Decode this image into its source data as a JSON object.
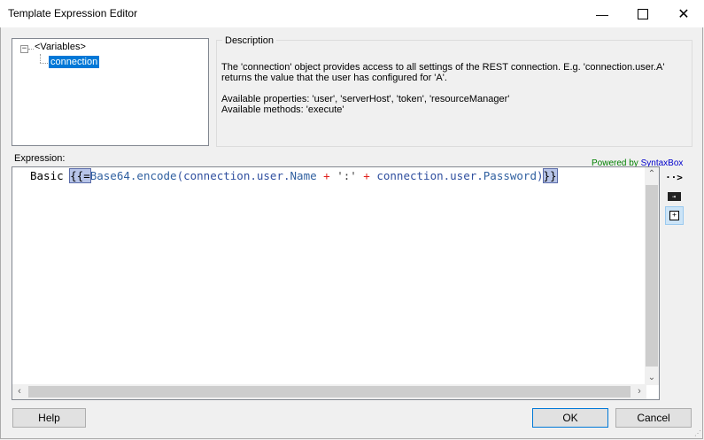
{
  "window": {
    "title": "Template Expression Editor",
    "minimize_icon": "minimize-icon",
    "maximize_icon": "maximize-icon",
    "close_icon": "close-icon"
  },
  "tree": {
    "root_label": "<Variables>",
    "expander": "−",
    "child_label": "connection"
  },
  "description": {
    "legend": "Description",
    "line1": "The 'connection' object provides access to all settings of the REST connection. E.g. 'connection.user.A'",
    "line2": "returns the value that the user has configured for 'A'.",
    "line3": "Available properties: 'user', 'serverHost', 'token', 'resourceManager'",
    "line4": "Available methods: 'execute'"
  },
  "expression": {
    "label": "Expression:",
    "powered_prefix": "Powered by ",
    "powered_link": "SyntaxBox",
    "code": {
      "t1": "Basic ",
      "t2": "{{=",
      "t3": "Base64",
      "t4": ".",
      "t5": "encode",
      "t6": "(connection.user.",
      "t7": "Name",
      "t8": " + ",
      "t9": "':'",
      "t10": " + ",
      "t11": "connection.user.",
      "t12": "Password",
      "t13": ")",
      "t14": "}}"
    }
  },
  "side_toolbar": {
    "insert_icon": "arrow-insert-icon",
    "insert_glyph": "··>",
    "keyboard_icon": "keyboard-icon",
    "keyboard_glyph": "⇥",
    "expand_icon": "expand-tree-icon",
    "expand_glyph": "+"
  },
  "buttons": {
    "help": "Help",
    "ok": "OK",
    "cancel": "Cancel"
  }
}
